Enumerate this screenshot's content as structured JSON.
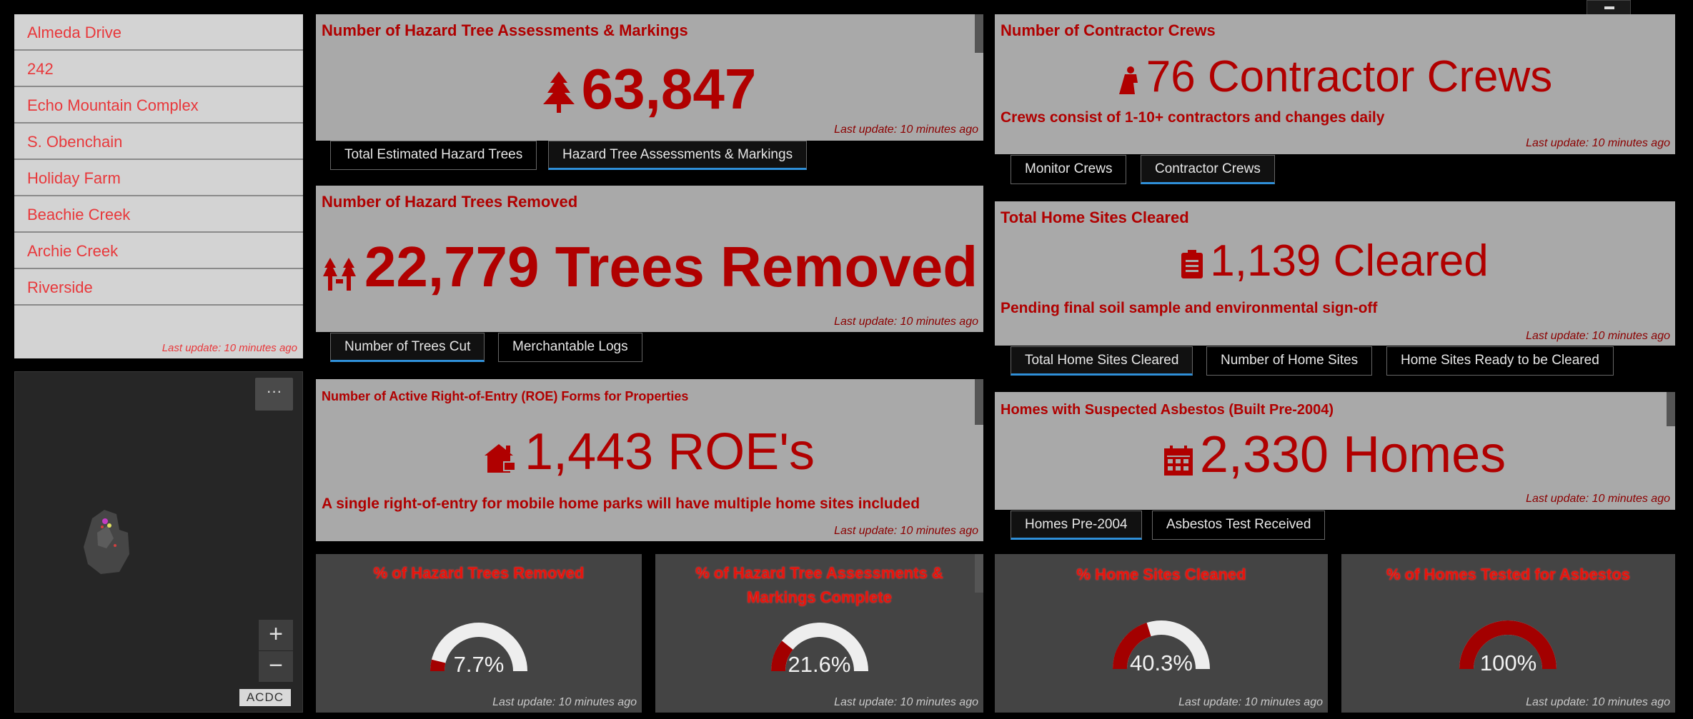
{
  "fire_list": {
    "items": [
      "Almeda Drive",
      "242",
      "Echo Mountain Complex",
      "S. Obenchain",
      "Holiday Farm",
      "Beachie Creek",
      "Archie Creek",
      "Riverside"
    ],
    "last_update": "Last update: 10 minutes ago"
  },
  "map": {
    "menu": "···",
    "zoom_in": "+",
    "zoom_out": "−",
    "attribution": "ACDC"
  },
  "hazard_assess": {
    "title": "Number of Hazard Tree Assessments & Markings",
    "value": "63,847",
    "icon": "tree-icon",
    "last_update": "Last update: 10 minutes ago",
    "tabs": [
      "Total Estimated Hazard Trees",
      "Hazard Tree Assessments & Markings"
    ]
  },
  "trees_removed": {
    "title": "Number of Hazard Trees Removed",
    "value": "22,779 Trees Removed",
    "icon": "cut-trees-icon",
    "last_update": "Last update: 10 minutes ago",
    "tabs": [
      "Number of Trees Cut",
      "Merchantable Logs"
    ]
  },
  "roe": {
    "title": "Number of Active Right-of-Entry (ROE) Forms for Properties",
    "value": "1,443 ROE's",
    "icon": "house-icon",
    "note": "A single right-of-entry for mobile home parks will have multiple home sites included",
    "last_update": "Last update: 10 minutes ago"
  },
  "crews": {
    "title": "Number of Contractor Crews",
    "value": "76 Contractor Crews",
    "icon": "worker-icon",
    "note": "Crews consist of 1-10+ contractors and changes daily",
    "last_update": "Last update: 10 minutes ago",
    "tabs": [
      "Monitor Crews",
      "Contractor Crews"
    ]
  },
  "home_sites": {
    "title": "Total Home Sites Cleared",
    "value": "1,139 Cleared",
    "icon": "clipboard-icon",
    "note": "Pending final soil sample and environmental sign-off",
    "last_update": "Last update: 10 minutes ago",
    "tabs": [
      "Total Home Sites Cleared",
      "Number of Home Sites",
      "Home Sites Ready to be Cleared"
    ]
  },
  "asbestos": {
    "title": "Homes with Suspected Asbestos (Built Pre-2004)",
    "value": "2,330 Homes",
    "icon": "calendar-icon",
    "last_update": "Last update: 10 minutes ago",
    "tabs": [
      "Homes Pre-2004",
      "Asbestos Test Received"
    ]
  },
  "gauges": [
    {
      "title": "% of Hazard Trees Removed",
      "value_text": "7.7%",
      "fraction": 0.077,
      "last_update": "Last update: 10 minutes ago"
    },
    {
      "title": "% of Hazard Tree Assessments & Markings Complete",
      "value_text": "21.6%",
      "fraction": 0.216,
      "last_update": "Last update: 10 minutes ago"
    },
    {
      "title": "% Home Sites Cleaned",
      "value_text": "40.3%",
      "fraction": 0.403,
      "last_update": "Last update: 10 minutes ago"
    },
    {
      "title": "% of Homes Tested for Asbestos",
      "value_text": "100%",
      "fraction": 1.0,
      "last_update": "Last update: 10 minutes ago"
    }
  ],
  "colors": {
    "accent_red": "#b00000",
    "gauge_fill": "#a30000",
    "gauge_track": "#eeeeee",
    "tab_active": "#2f8fd8"
  }
}
